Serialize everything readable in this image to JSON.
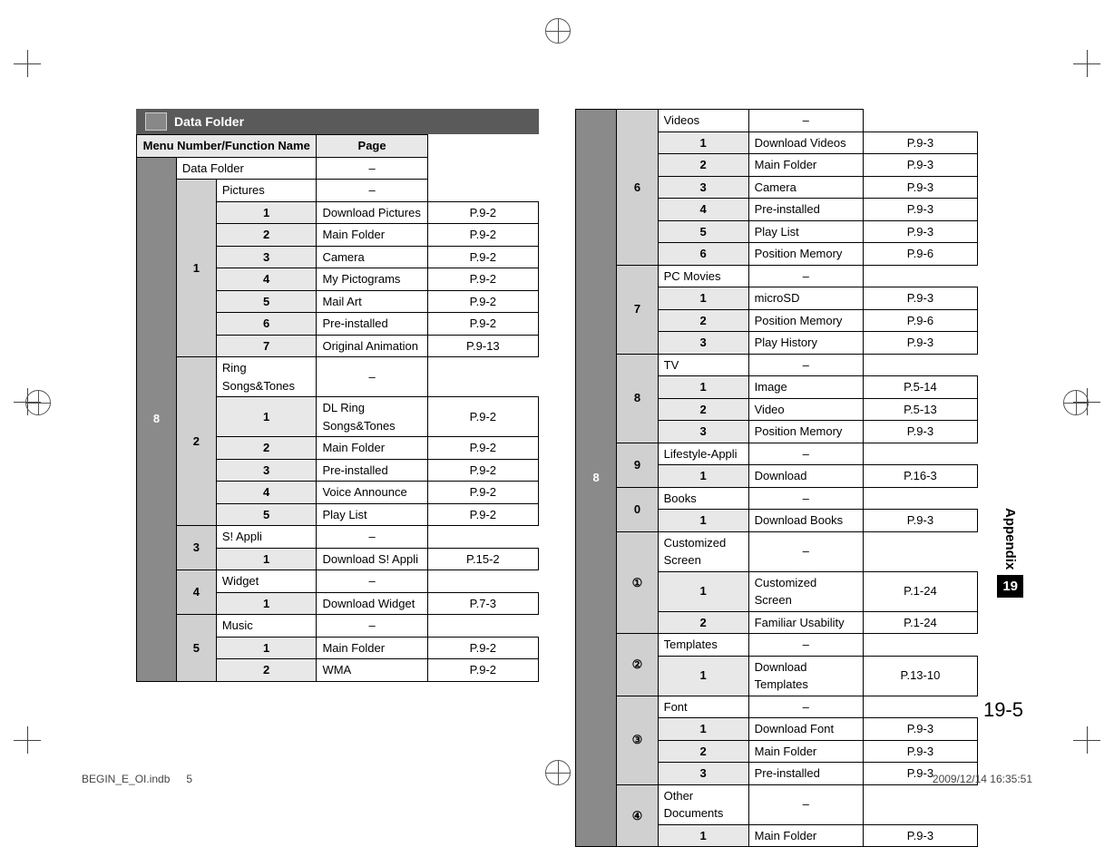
{
  "section_title": "Data Folder",
  "header_menu": "Menu Number/Function Name",
  "header_page": "Page",
  "left_table": [
    {
      "type": "lvl0",
      "num": "8",
      "name": "Data Folder",
      "page": "–"
    },
    {
      "type": "lvl1",
      "num": "1",
      "name": "Pictures",
      "page": "–"
    },
    {
      "type": "lvl2",
      "num": "1",
      "name": "Download Pictures",
      "page": "P.9-2"
    },
    {
      "type": "lvl2",
      "num": "2",
      "name": "Main Folder",
      "page": "P.9-2"
    },
    {
      "type": "lvl2",
      "num": "3",
      "name": "Camera",
      "page": "P.9-2"
    },
    {
      "type": "lvl2",
      "num": "4",
      "name": "My Pictograms",
      "page": "P.9-2"
    },
    {
      "type": "lvl2",
      "num": "5",
      "name": "Mail Art",
      "page": "P.9-2"
    },
    {
      "type": "lvl2",
      "num": "6",
      "name": "Pre-installed",
      "page": "P.9-2"
    },
    {
      "type": "lvl2",
      "num": "7",
      "name": "Original Animation",
      "page": "P.9-13"
    },
    {
      "type": "lvl1",
      "num": "2",
      "name": "Ring Songs&Tones",
      "page": "–"
    },
    {
      "type": "lvl2",
      "num": "1",
      "name": "DL Ring Songs&Tones",
      "page": "P.9-2"
    },
    {
      "type": "lvl2",
      "num": "2",
      "name": "Main Folder",
      "page": "P.9-2"
    },
    {
      "type": "lvl2",
      "num": "3",
      "name": "Pre-installed",
      "page": "P.9-2"
    },
    {
      "type": "lvl2",
      "num": "4",
      "name": "Voice Announce",
      "page": "P.9-2"
    },
    {
      "type": "lvl2",
      "num": "5",
      "name": "Play List",
      "page": "P.9-2"
    },
    {
      "type": "lvl1",
      "num": "3",
      "name": "S! Appli",
      "page": "–"
    },
    {
      "type": "lvl2",
      "num": "1",
      "name": "Download S! Appli",
      "page": "P.15-2"
    },
    {
      "type": "lvl1",
      "num": "4",
      "name": "Widget",
      "page": "–"
    },
    {
      "type": "lvl2",
      "num": "1",
      "name": "Download Widget",
      "page": "P.7-3"
    },
    {
      "type": "lvl1",
      "num": "5",
      "name": "Music",
      "page": "–"
    },
    {
      "type": "lvl2",
      "num": "1",
      "name": "Main Folder",
      "page": "P.9-2"
    },
    {
      "type": "lvl2",
      "num": "2",
      "name": "WMA",
      "page": "P.9-2"
    }
  ],
  "right_table": [
    {
      "type": "lvl0",
      "num": "8",
      "name": null,
      "page": null,
      "continue": true
    },
    {
      "type": "lvl1",
      "num": "6",
      "name": "Videos",
      "page": "–"
    },
    {
      "type": "lvl2",
      "num": "1",
      "name": "Download Videos",
      "page": "P.9-3"
    },
    {
      "type": "lvl2",
      "num": "2",
      "name": "Main Folder",
      "page": "P.9-3"
    },
    {
      "type": "lvl2",
      "num": "3",
      "name": "Camera",
      "page": "P.9-3"
    },
    {
      "type": "lvl2",
      "num": "4",
      "name": "Pre-installed",
      "page": "P.9-3"
    },
    {
      "type": "lvl2",
      "num": "5",
      "name": "Play List",
      "page": "P.9-3"
    },
    {
      "type": "lvl2",
      "num": "6",
      "name": "Position Memory",
      "page": "P.9-6"
    },
    {
      "type": "lvl1",
      "num": "7",
      "name": "PC Movies",
      "page": "–"
    },
    {
      "type": "lvl2",
      "num": "1",
      "name": "microSD",
      "page": "P.9-3"
    },
    {
      "type": "lvl2",
      "num": "2",
      "name": "Position Memory",
      "page": "P.9-6"
    },
    {
      "type": "lvl2",
      "num": "3",
      "name": "Play History",
      "page": "P.9-3"
    },
    {
      "type": "lvl1",
      "num": "8",
      "name": "TV",
      "page": "–"
    },
    {
      "type": "lvl2",
      "num": "1",
      "name": "Image",
      "page": "P.5-14"
    },
    {
      "type": "lvl2",
      "num": "2",
      "name": "Video",
      "page": "P.5-13"
    },
    {
      "type": "lvl2",
      "num": "3",
      "name": "Position Memory",
      "page": "P.9-3"
    },
    {
      "type": "lvl1",
      "num": "9",
      "name": "Lifestyle-Appli",
      "page": "–"
    },
    {
      "type": "lvl2",
      "num": "1",
      "name": "Download",
      "page": "P.16-3"
    },
    {
      "type": "lvl1",
      "num": "0",
      "name": "Books",
      "page": "–"
    },
    {
      "type": "lvl2",
      "num": "1",
      "name": "Download Books",
      "page": "P.9-3"
    },
    {
      "type": "lvl1",
      "num": "①",
      "name": "Customized Screen",
      "page": "–"
    },
    {
      "type": "lvl2",
      "num": "1",
      "name": "Customized Screen",
      "page": "P.1-24"
    },
    {
      "type": "lvl2",
      "num": "2",
      "name": "Familiar Usability",
      "page": "P.1-24"
    },
    {
      "type": "lvl1",
      "num": "②",
      "name": "Templates",
      "page": "–"
    },
    {
      "type": "lvl2",
      "num": "1",
      "name": "Download Templates",
      "page": "P.13-10"
    },
    {
      "type": "lvl1",
      "num": "③",
      "name": "Font",
      "page": "–"
    },
    {
      "type": "lvl2",
      "num": "1",
      "name": "Download Font",
      "page": "P.9-3"
    },
    {
      "type": "lvl2",
      "num": "2",
      "name": "Main Folder",
      "page": "P.9-3"
    },
    {
      "type": "lvl2",
      "num": "3",
      "name": "Pre-installed",
      "page": "P.9-3"
    },
    {
      "type": "lvl1",
      "num": "④",
      "name": "Other Documents",
      "page": "–"
    },
    {
      "type": "lvl2",
      "num": "1",
      "name": "Main Folder",
      "page": "P.9-3"
    }
  ],
  "side_label": "Appendix",
  "side_chip": "19",
  "page_number": "19-5",
  "footer_file": "BEGIN_E_OI.indb",
  "footer_page": "5",
  "footer_ts": "2009/12/14   16:35:51"
}
